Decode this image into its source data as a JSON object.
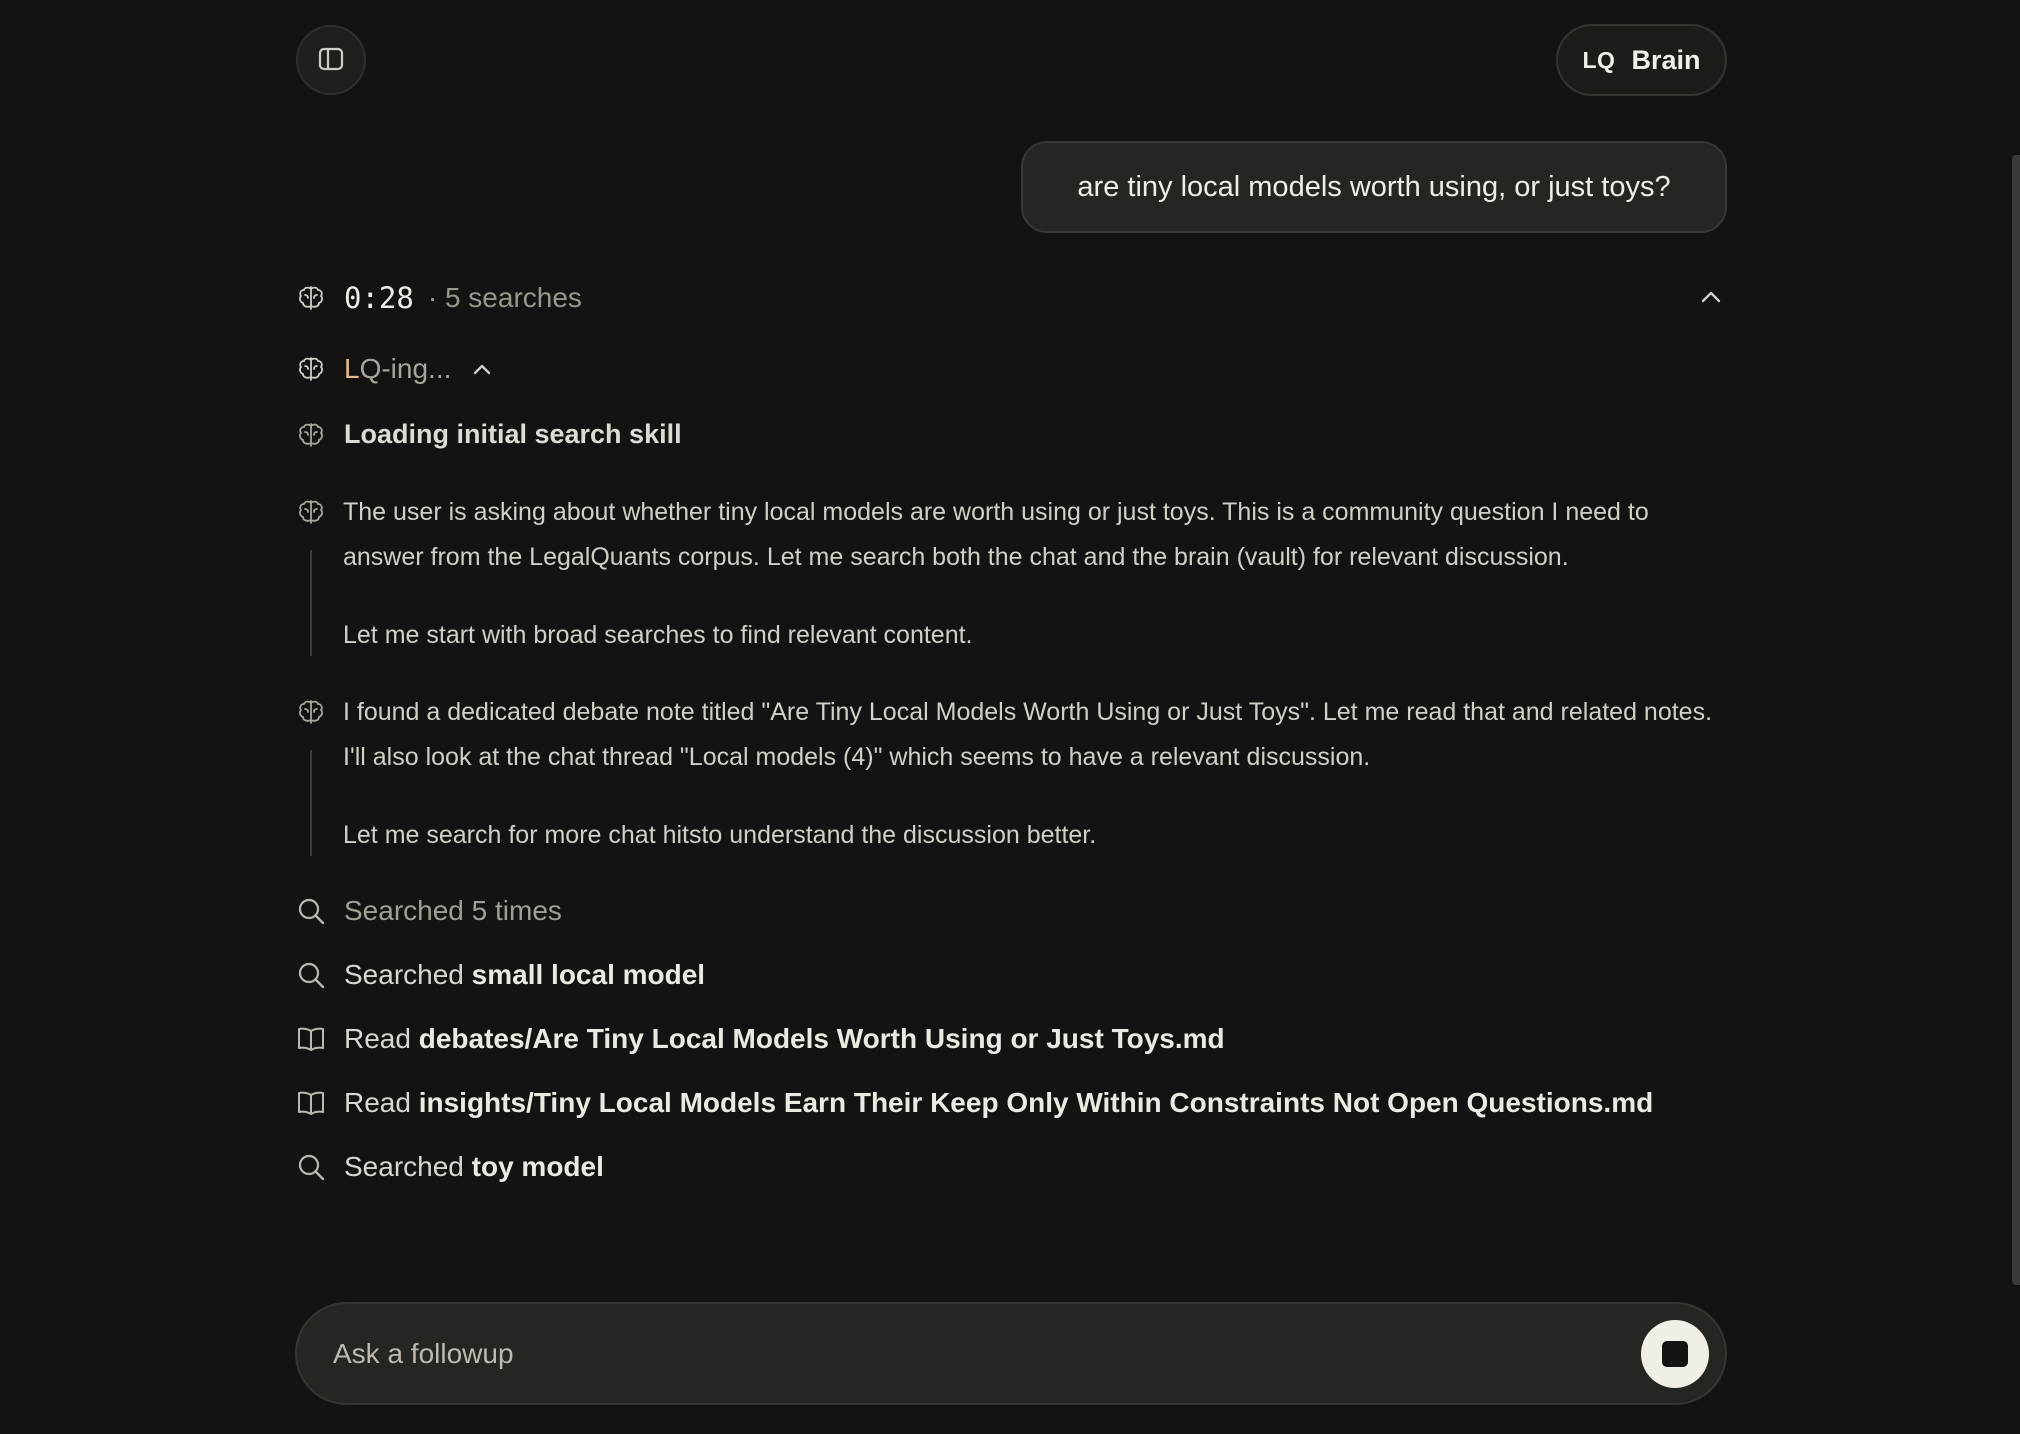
{
  "header": {
    "sidebar_toggle_icon": "sidebar-panel-icon",
    "brand_mark": "LQ",
    "brand_name": "Brain"
  },
  "conversation": {
    "user_message": "are tiny local models worth using, or just toys?"
  },
  "trace": {
    "timer": "0:28",
    "summary": "· 5 searches",
    "status_first_letter": "L",
    "status_rest": "Q-ing...",
    "step_title": "Loading initial search skill",
    "thoughts": [
      {
        "paragraph_1": "The user is asking about whether tiny local models are worth using or just toys. This is a community question I need to answer from the LegalQuants corpus. Let me search both the chat and the brain (vault) for relevant discussion.",
        "paragraph_2": "Let me start with broad searches to find relevant content."
      },
      {
        "paragraph_1": "I found a dedicated debate note titled \"Are Tiny Local Models Worth Using or Just Toys\". Let me read that and related notes. I'll also look at the chat thread \"Local models (4)\" which seems to have a relevant discussion.",
        "paragraph_2": "Let me search for more chat hitsto understand the discussion better."
      }
    ],
    "actions": [
      {
        "icon": "search-icon",
        "verb": "Searched 5 times",
        "target": ""
      },
      {
        "icon": "search-icon",
        "verb": "Searched",
        "target": "small local model"
      },
      {
        "icon": "book-icon",
        "verb": "Read",
        "target": "debates/Are Tiny Local Models Worth Using or Just Toys.md"
      },
      {
        "icon": "book-icon",
        "verb": "Read",
        "target": "insights/Tiny Local Models Earn Their Keep Only Within Constraints Not Open Questions.md"
      },
      {
        "icon": "search-icon",
        "verb": "Searched",
        "target": "toy model"
      }
    ]
  },
  "composer": {
    "placeholder": "Ask a followup",
    "stop_icon": "stop-icon"
  },
  "colors": {
    "background": "#141311",
    "accent_letter": "#e6b98d",
    "bubble": "#252522"
  }
}
